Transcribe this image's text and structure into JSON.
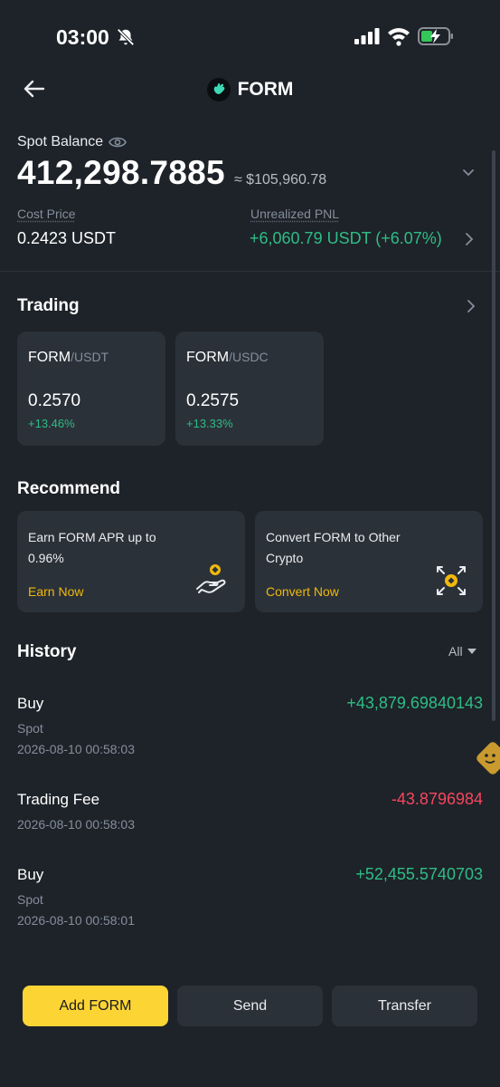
{
  "status_bar": {
    "time": "03:00"
  },
  "header": {
    "title": "FORM"
  },
  "balance": {
    "label": "Spot Balance",
    "value": "412,298.7885",
    "usd_equivalent": "≈ $105,960.78",
    "cost_price_label": "Cost Price",
    "cost_price_value": "0.2423 USDT",
    "pnl_label": "Unrealized PNL",
    "pnl_value": "+6,060.79 USDT (+6.07%)"
  },
  "trading": {
    "title": "Trading",
    "pairs": [
      {
        "base": "FORM",
        "quote": "/USDT",
        "price": "0.2570",
        "change": "+13.46%"
      },
      {
        "base": "FORM",
        "quote": "/USDC",
        "price": "0.2575",
        "change": "+13.33%"
      }
    ]
  },
  "recommend": {
    "title": "Recommend",
    "cards": [
      {
        "text": "Earn FORM APR up to 0.96%",
        "link": "Earn Now",
        "icon": "earn-hand-coin-icon"
      },
      {
        "text": "Convert FORM to Other Crypto",
        "link": "Convert Now",
        "icon": "convert-coin-icon"
      }
    ]
  },
  "history": {
    "title": "History",
    "filter": "All",
    "items": [
      {
        "type": "Buy",
        "amount": "+43,879.69840143",
        "direction": "pos",
        "account": "Spot",
        "time": "2026-08-10 00:58:03"
      },
      {
        "type": "Trading Fee",
        "amount": "-43.8796984",
        "direction": "neg",
        "account": "",
        "time": "2026-08-10 00:58:03"
      },
      {
        "type": "Buy",
        "amount": "+52,455.5740703",
        "direction": "pos",
        "account": "Spot",
        "time": "2026-08-10 00:58:01"
      }
    ]
  },
  "actions": {
    "add_label": "Add FORM",
    "send_label": "Send",
    "transfer_label": "Transfer"
  },
  "colors": {
    "background": "#1e2329",
    "card": "#2b3139",
    "positive": "#2ebd85",
    "negative": "#f6465d",
    "accent": "#fcd535",
    "link": "#f0b90b"
  }
}
